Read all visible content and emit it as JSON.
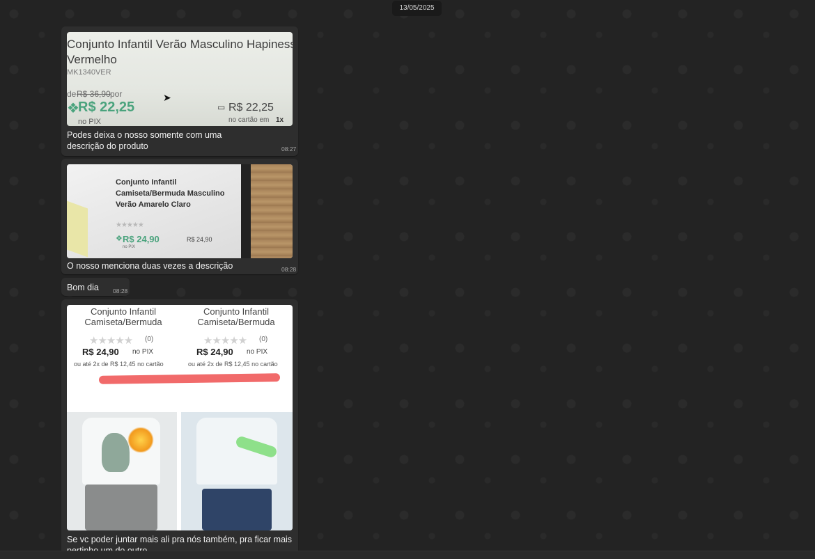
{
  "date_chip": "13/05/2025",
  "messages": [
    {
      "caption_line1": "Podes deixa o nosso somente com uma",
      "caption_line2": "descrição do produto",
      "time": "08:27",
      "image": {
        "title_line1": "Conjunto Infantil Verão Masculino Hapiness",
        "title_line2": "Vermelho",
        "sku": "MK1340VER",
        "old_price_prefix": "de",
        "old_price": "R$ 36,90",
        "old_price_suffix": "por",
        "pix_price": "R$ 22,25",
        "pix_label": "no PIX",
        "card_price": "R$ 22,25",
        "card_label": "no cartão em",
        "card_installments": "1x"
      }
    },
    {
      "caption": "O nosso menciona duas vezes a descrição",
      "time": "08:28",
      "image": {
        "title_line1": "Conjunto Infantil",
        "title_line2": "Camiseta/Bermuda Masculino",
        "title_line3": "Verão Amarelo Claro",
        "pix_price": "R$ 24,90",
        "pix_label": "no PIX",
        "card_price": "R$ 24,90"
      }
    },
    {
      "text": "Bom dia",
      "time": "08:28"
    },
    {
      "caption_line1": "Se vc poder juntar mais ali pra nós também, pra ficar mais",
      "caption_line2": "pertinho um do outro",
      "image": {
        "products": [
          {
            "title_line1": "Conjunto Infantil",
            "title_line2": "Camiseta/Bermuda",
            "rating_count": "(0)",
            "price": "R$ 24,90",
            "price_label": "no PIX",
            "installments": "ou até 2x de R$ 12,45 no cartão"
          },
          {
            "title_line1": "Conjunto Infantil",
            "title_line2": "Camiseta/Bermuda",
            "rating_count": "(0)",
            "price": "R$ 24,90",
            "price_label": "no PIX",
            "installments": "ou até 2x de R$ 12,45 no cartão"
          }
        ]
      }
    }
  ],
  "colors": {
    "price_green": "#4aa37d",
    "highlight_red": "#f05a5a",
    "bubble": "#2e2e2e",
    "background": "#232323"
  }
}
